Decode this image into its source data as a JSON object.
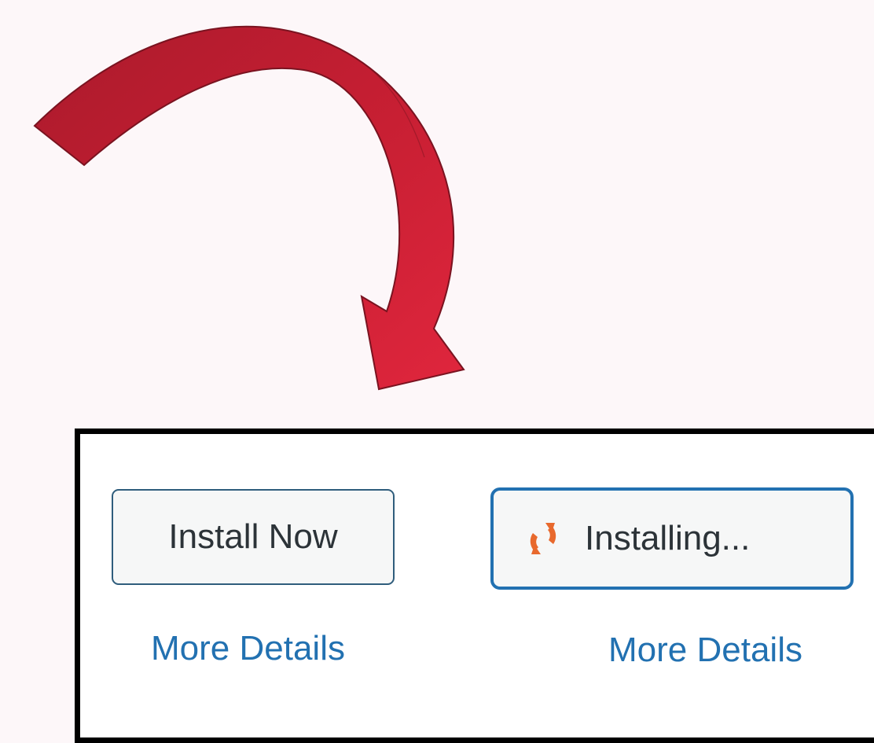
{
  "colors": {
    "background": "#fdf7f9",
    "arrow_dark": "#ab1a2c",
    "arrow_light": "#e0263d",
    "frame_border": "#000000",
    "button_border": "#2f5d7c",
    "button_active_border": "#2271b1",
    "button_bg": "#f6f7f7",
    "button_text": "#2c3338",
    "link": "#2271b1",
    "spinner": "#e8692d"
  },
  "annotation": {
    "icon": "curved-arrow-icon"
  },
  "cards": [
    {
      "button_label": "Install Now",
      "link_label": "More Details"
    },
    {
      "button_label": "Installing...",
      "button_icon": "update-spinner-icon",
      "link_label": "More Details"
    }
  ]
}
